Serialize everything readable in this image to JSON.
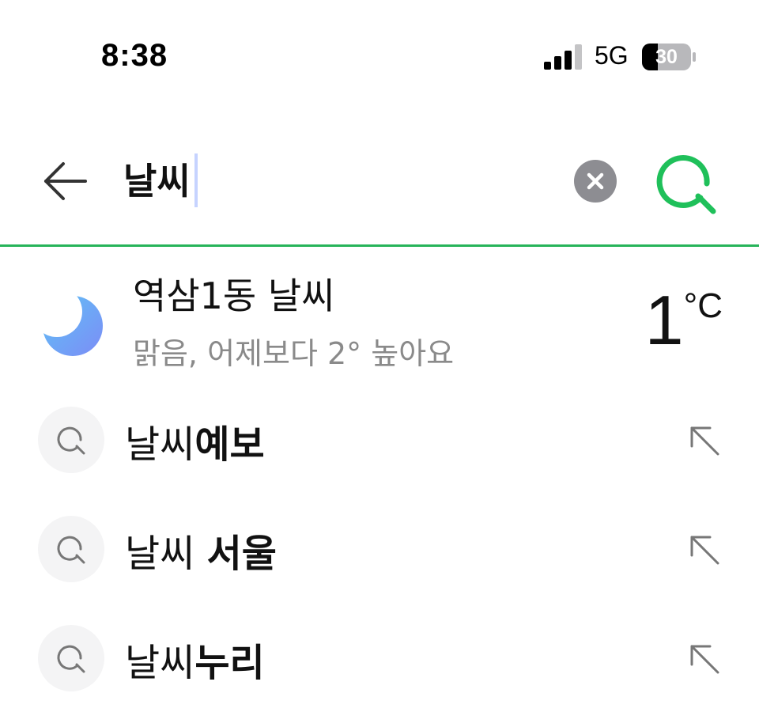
{
  "status_bar": {
    "time": "8:38",
    "network": "5G",
    "battery": "30"
  },
  "search": {
    "query": "날씨",
    "accent_color": "#27b45a"
  },
  "weather": {
    "location_title": "역삼1동 날씨",
    "summary": "맑음, 어제보다 2° 높아요",
    "temperature": "1",
    "unit": "°C",
    "icon": "crescent-moon-icon"
  },
  "suggestions": [
    {
      "query_part": "날씨",
      "rest": "예보"
    },
    {
      "query_part": "날씨 ",
      "rest": "서울"
    },
    {
      "query_part": "날씨",
      "rest": "누리"
    }
  ]
}
